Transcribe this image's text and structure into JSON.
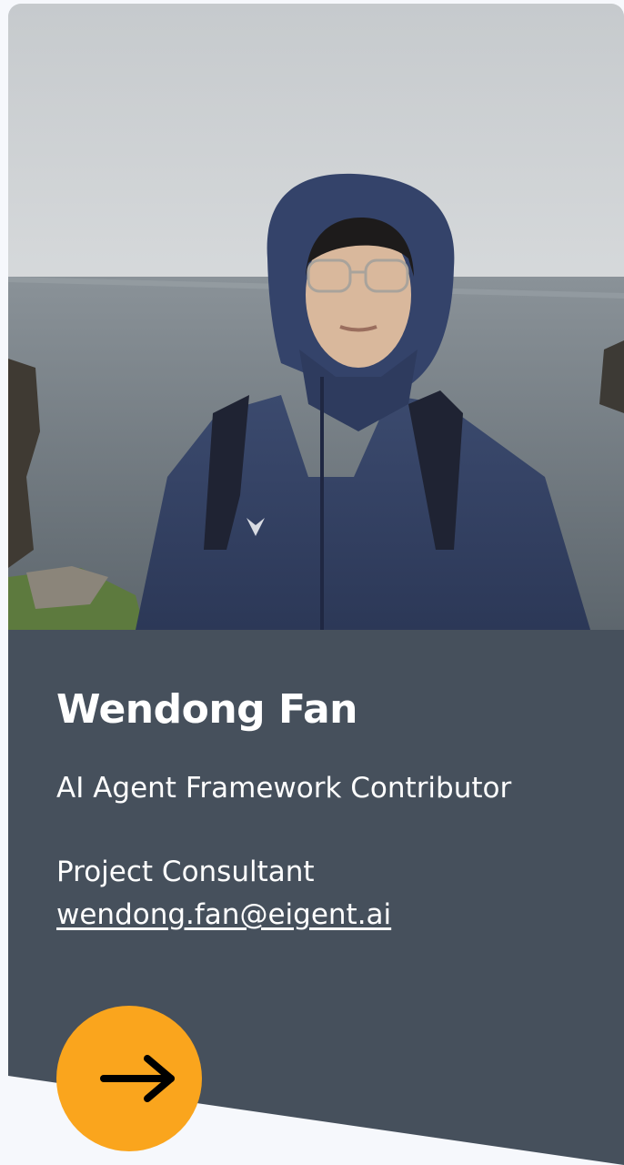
{
  "member": {
    "photo_alt": "Wendong Fan",
    "name": "Wendong Fan",
    "role": "AI Agent Framework Contributor",
    "position": "Project Consultant",
    "email": "wendong.fan@eigent.ai",
    "email_href": "mailto:wendong.fan@eigent.ai"
  },
  "icons": {
    "action_icon": "arrow-right-icon"
  },
  "colors": {
    "panel_bg": "#46505c",
    "accent": "#faa51d",
    "text": "#ffffff",
    "page_bg": "#f6f8fc"
  }
}
